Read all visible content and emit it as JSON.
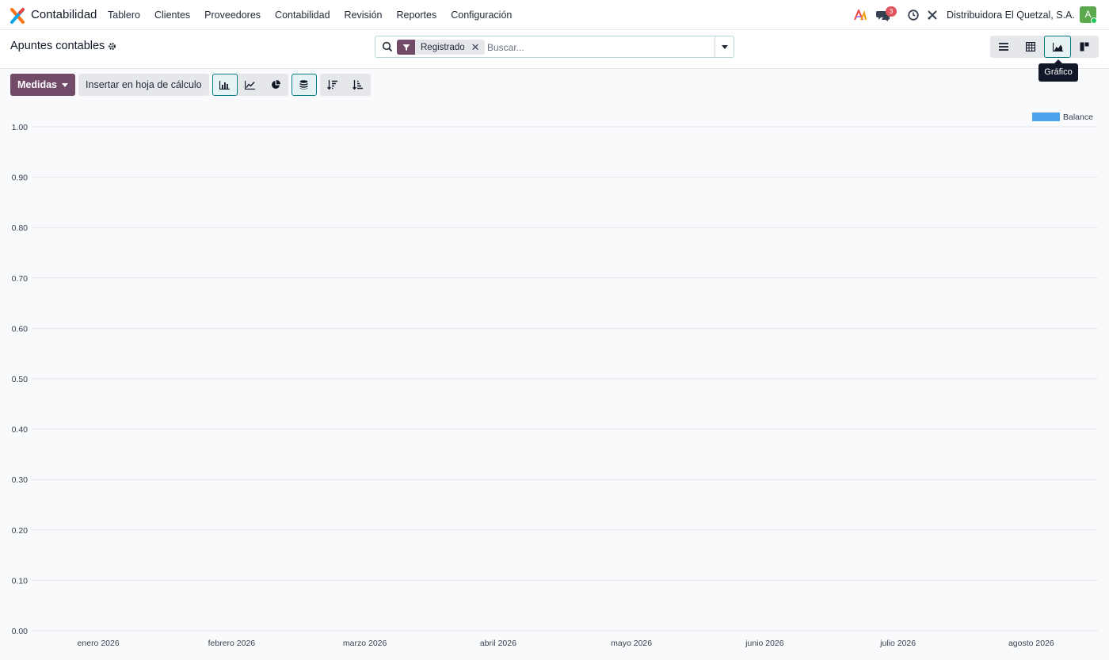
{
  "navbar": {
    "app_name": "Contabilidad",
    "menu": [
      "Tablero",
      "Clientes",
      "Proveedores",
      "Contabilidad",
      "Revisión",
      "Reportes",
      "Configuración"
    ],
    "messages_count": "3",
    "company": "Distribuidora El Quetzal, S.A.",
    "avatar_initial": "A"
  },
  "control_panel": {
    "title": "Apuntes contables",
    "facet": "Registrado",
    "search_placeholder": "Buscar...",
    "tooltip": "Gráfico"
  },
  "toolbar": {
    "measures_label": "Medidas",
    "spreadsheet_label": "Insertar en hoja de cálculo"
  },
  "colors": {
    "brand": "#714b67",
    "accent": "#017e84",
    "series": "#4ea4ec"
  },
  "chart_data": {
    "type": "bar",
    "categories": [
      "enero 2026",
      "febrero 2026",
      "marzo 2026",
      "abril 2026",
      "mayo 2026",
      "junio 2026",
      "julio 2026",
      "agosto 2026"
    ],
    "series": [
      {
        "name": "Balance",
        "values": [
          0,
          0,
          0,
          0,
          0,
          0,
          0,
          0
        ]
      }
    ],
    "yticks": [
      "0.00",
      "0.10",
      "0.20",
      "0.30",
      "0.40",
      "0.50",
      "0.60",
      "0.70",
      "0.80",
      "0.90",
      "1.00"
    ],
    "ylim": [
      0,
      1
    ],
    "grid": true,
    "legend": "top-right"
  }
}
